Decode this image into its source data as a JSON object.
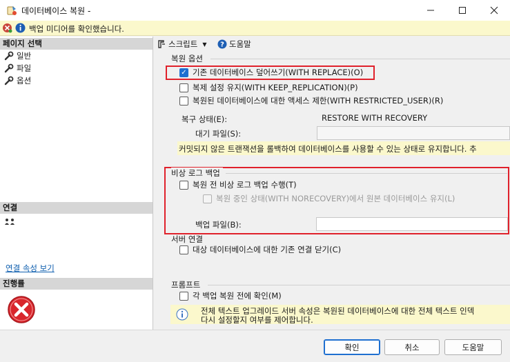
{
  "window": {
    "title": "데이터베이스 복원 -"
  },
  "message_bar": {
    "text": "백업 미디어를 확인했습니다."
  },
  "left_pane": {
    "page_select_header": "페이지 선택",
    "pages": [
      {
        "label": "일반"
      },
      {
        "label": "파일"
      },
      {
        "label": "옵션"
      }
    ],
    "connection_header": "연결",
    "connection_link": "연결 속성 보기",
    "progress_header": "진행률"
  },
  "toolbar": {
    "script_label": "스크립트",
    "help_label": "도움말"
  },
  "restore_options": {
    "group_label": "복원 옵션",
    "overwrite": {
      "label": "기존 데이터베이스 덮어쓰기(WITH REPLACE)(O)",
      "checked": true
    },
    "keep_replication": {
      "label": "복제 설정 유지(WITH KEEP_REPLICATION)(P)",
      "checked": false
    },
    "restricted_user": {
      "label": "복원된 데이터베이스에 대한 액세스 제한(WITH RESTRICTED_USER)(R)",
      "checked": false
    },
    "recovery_state_label": "복구 상태(E):",
    "recovery_state_value": "RESTORE WITH RECOVERY",
    "standby_file_label": "대기 파일(S):",
    "standby_file_value": "",
    "recovery_note": "커밋되지 않은 트랜잭션을 롤백하여 데이터베이스를 사용할 수 있는 상태로 유지합니다. 추"
  },
  "tail_log": {
    "group_label": "비상 로그 백업",
    "take_tail_log": {
      "label": "복원 전 비상 로그 백업 수행(T)",
      "checked": false
    },
    "leave_norecovery": {
      "label": "복원 중인 상태(WITH NORECOVERY)에서 원본 데이터베이스 유지(L)",
      "checked": false
    },
    "backup_file_label": "백업 파일(B):",
    "backup_file_value": ""
  },
  "server_connections": {
    "group_label": "서버 연결",
    "close_connections": {
      "label": "대상 데이터베이스에 대한 기존 연결 닫기(C)",
      "checked": false
    }
  },
  "prompt": {
    "group_label": "프롬프트",
    "prompt_before_each": {
      "label": "각 백업 복원 전에 확인(M)",
      "checked": false
    },
    "fulltext_note_line1": "전체 텍스트 업그레이드 서버 속성은 복원된 데이터베이스에 대한 전체 텍스트 인덱",
    "fulltext_note_line2": "다시 설정할지 여부를 제어합니다."
  },
  "buttons": {
    "ok": "확인",
    "cancel": "취소",
    "help": "도움말"
  },
  "colors": {
    "accent": "#1e6fd0",
    "highlight_border": "#e0202a",
    "message_bar_bg": "#fbf8cc",
    "error_icon": "#d9262c"
  }
}
